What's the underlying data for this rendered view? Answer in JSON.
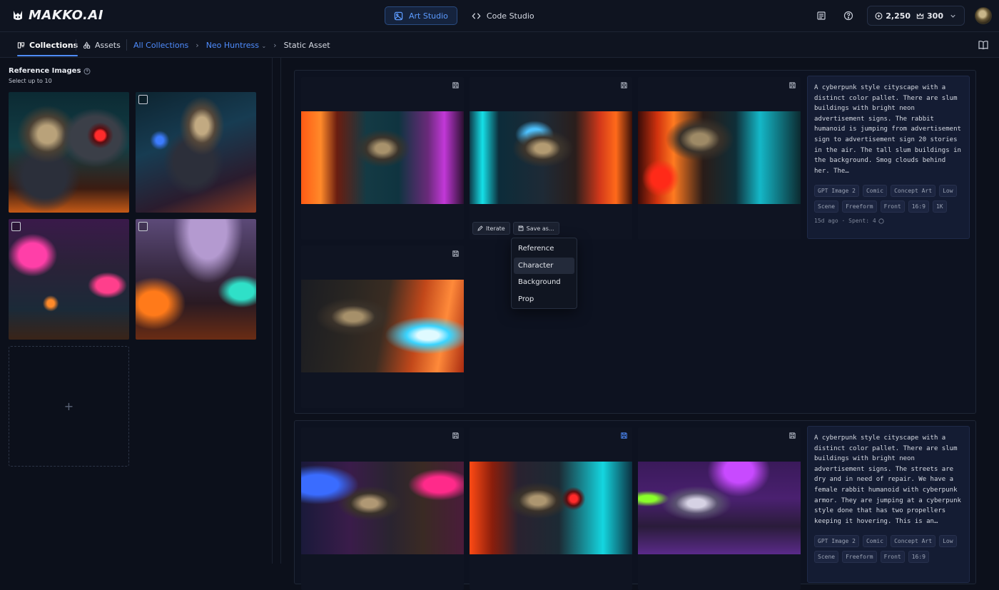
{
  "app": {
    "logo": "MAKKO.AI"
  },
  "modes": [
    {
      "label": "Art Studio",
      "active": true
    },
    {
      "label": "Code Studio",
      "active": false
    }
  ],
  "credits": {
    "coins": "2,250",
    "crowns": "300"
  },
  "subnav": {
    "collections": "Collections",
    "assets": "Assets",
    "breadcrumb": {
      "all": "All Collections",
      "collection": "Neo Huntress",
      "current": "Static Asset"
    }
  },
  "reference": {
    "title": "Reference Images",
    "subtitle": "Select up to 10",
    "add_symbol": "+"
  },
  "generations": [
    {
      "description": "A cyberpunk style cityscape with a distinct color pallet. There are slum buildings with bright neon advertisement signs. The rabbit humanoid is jumping from advertisement sign to advertisement sign 20 stories in the air. The tall slum buildings in the background. Smog clouds behind her. The…",
      "tags": [
        "GPT Image 2",
        "Comic",
        "Concept Art",
        "Low",
        "Scene",
        "Freeform",
        "Front",
        "16:9",
        "1K"
      ],
      "meta": "15d ago · Spent: 4"
    },
    {
      "description": "A cyberpunk style cityscape with a distinct color pallet. There are slum buildings with bright neon advertisement signs. The streets are dry and in need of repair. We have a female rabbit humanoid with cyberpunk armor. They are jumping at a cyberpunk style done that has two propellers keeping it hovering. This is an…",
      "tags": [
        "GPT Image 2",
        "Comic",
        "Concept Art",
        "Low",
        "Scene",
        "Freeform",
        "Front",
        "16:9"
      ]
    }
  ],
  "actions": {
    "iterate": "Iterate",
    "save_as": "Save as..."
  },
  "save_menu": [
    "Reference",
    "Character",
    "Background",
    "Prop"
  ],
  "colors": {
    "accent": "#4f8dff",
    "background": "#0c101b",
    "panel": "#141c33"
  }
}
